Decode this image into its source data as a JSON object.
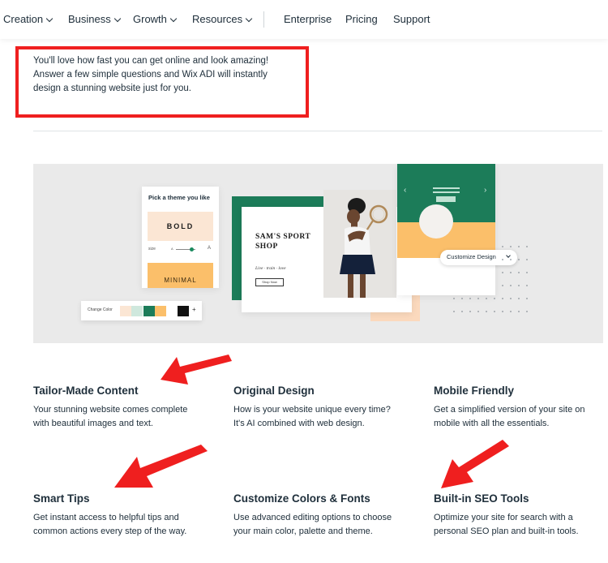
{
  "nav": {
    "items": [
      {
        "label": "Creation",
        "dropdown": true
      },
      {
        "label": "Business",
        "dropdown": true
      },
      {
        "label": "Growth",
        "dropdown": true
      },
      {
        "label": "Resources",
        "dropdown": true
      },
      {
        "label": "Enterprise",
        "dropdown": false
      },
      {
        "label": "Pricing",
        "dropdown": false
      },
      {
        "label": "Support",
        "dropdown": false
      }
    ]
  },
  "intro": {
    "line1": "You'll love how fast you can get online and look amazing!",
    "line2": "Answer a few simple questions and Wix ADI will instantly",
    "line3": "design a stunning website just for you."
  },
  "hero": {
    "theme_card": {
      "title": "Pick a theme you like",
      "bold_label": "BOLD",
      "size_label": "size",
      "size_small": "A",
      "size_large": "A",
      "minimal_label": "MINIMAL"
    },
    "color_bar": {
      "label": "Change Color",
      "swatches": [
        "#fbe6d4",
        "#cfe8dd",
        "#1c7c59",
        "#fbbf6a",
        "#111111"
      ],
      "plus": "+"
    },
    "site_preview": {
      "name_line1": "SAM'S SPORT",
      "name_line2": "SHOP",
      "tagline": "Live · train · love",
      "button": "Shop Now"
    },
    "mobile_preview": {
      "arrow_left": "‹",
      "arrow_right": "›"
    },
    "customize_label": "Customize Design"
  },
  "features": [
    {
      "title": "Tailor-Made Content",
      "line1": "Your stunning website comes complete",
      "line2": "with beautiful images and text."
    },
    {
      "title": "Original Design",
      "line1": "How is your website unique every time?",
      "line2": "It's AI combined with web design."
    },
    {
      "title": "Mobile Friendly",
      "line1": "Get a simplified version of your site on",
      "line2": "mobile with all the essentials."
    },
    {
      "title": "Smart Tips",
      "line1": "Get instant access to helpful tips and",
      "line2": "common actions every step of the way."
    },
    {
      "title": "Customize Colors & Fonts",
      "line1": "Use advanced editing options to choose",
      "line2": "your main color, palette and theme."
    },
    {
      "title": "Built-in SEO Tools",
      "line1": "Optimize your site for search with a",
      "line2": "personal SEO plan and built-in tools."
    }
  ],
  "colors": {
    "annotation_red": "#ef1f1f",
    "brand_green": "#1c7c59",
    "peach": "#fbe6d4",
    "orange": "#fbbf6a",
    "text": "#20303c"
  }
}
